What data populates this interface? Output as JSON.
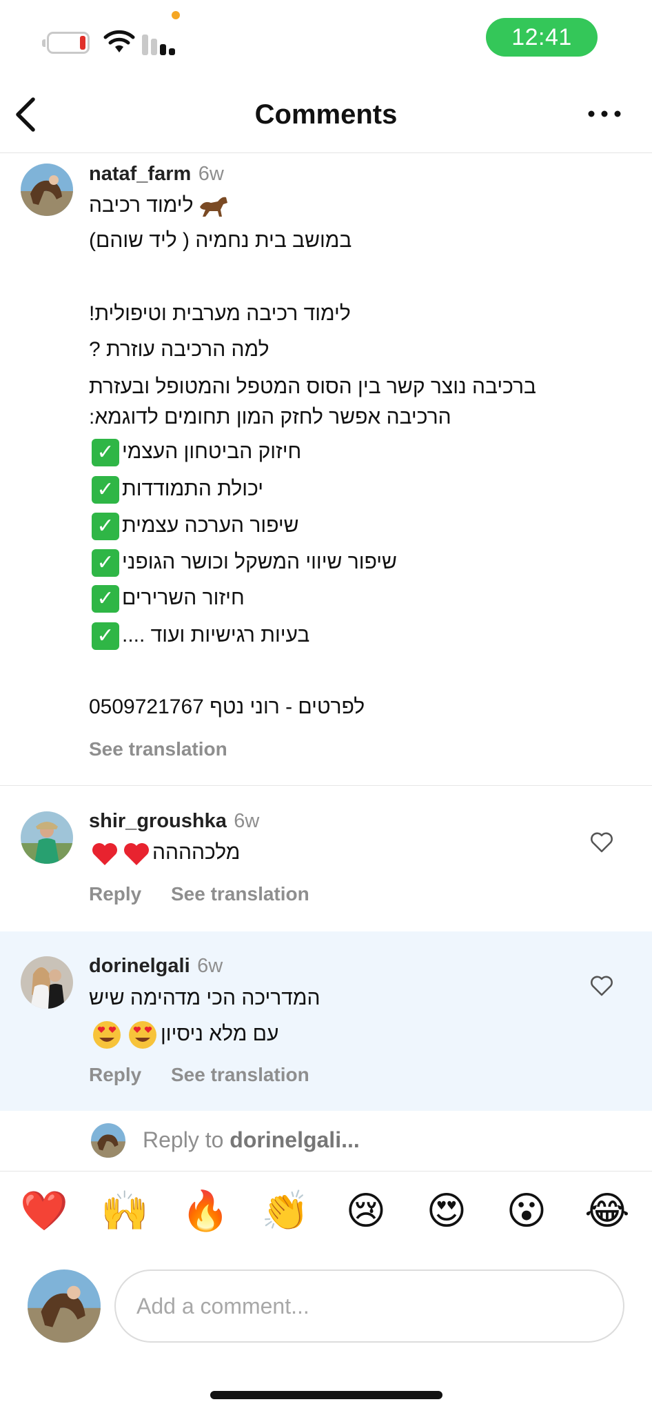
{
  "status_bar": {
    "time": "12:41",
    "battery_level": 0.1,
    "colors": {
      "time_pill": "#34c759",
      "battery_low": "#e0302a",
      "privacy_dot": "#f5a623"
    }
  },
  "header": {
    "title": "Comments",
    "back_icon": "chevron-left-icon",
    "more_icon": "more-horizontal-icon"
  },
  "caption": {
    "username": "nataf_farm",
    "time": "6w",
    "lines": [
      "לימוד רכיבה",
      "במושב בית נחמיה ( ליד שוהם)",
      "לימוד רכיבה מערבית וטיפולית!",
      "למה הרכיבה עוזרת ?",
      "ברכיבה נוצר קשר בין הסוס המטפל והמטופל ובעזרת",
      "הרכיבה אפשר לחזק המון תחומים לדוגמא:",
      "חיזוק הביטחון העצמי",
      "יכולת התמודדות",
      "שיפור הערכה עצמית",
      "שיפור שיווי המשקל וכושר הגופני",
      "חיזור השרירים",
      "בעיות רגישיות ועוד ....",
      "לפרטים - רוני נטף 0509721767"
    ],
    "see_translation": "See translation"
  },
  "comments": [
    {
      "username": "shir_groushka",
      "time": "6w",
      "lines": [
        "מלכהההה"
      ],
      "reply": "Reply",
      "see_translation": "See translation"
    },
    {
      "username": "dorinelgali",
      "time": "6w",
      "lines": [
        "המדריכה הכי מדהימה שיש",
        "עם מלא ניסיון"
      ],
      "reply": "Reply",
      "see_translation": "See translation"
    }
  ],
  "reply_to": {
    "prefix": "Reply to",
    "username": "dorinelgali...",
    "highlight_color": "#eff6fd"
  },
  "emoji_bar": [
    "❤️",
    "🙌",
    "🔥",
    "👏",
    "😢",
    "😍",
    "😮",
    "😂"
  ],
  "comment_input": {
    "placeholder": "Add a comment..."
  }
}
